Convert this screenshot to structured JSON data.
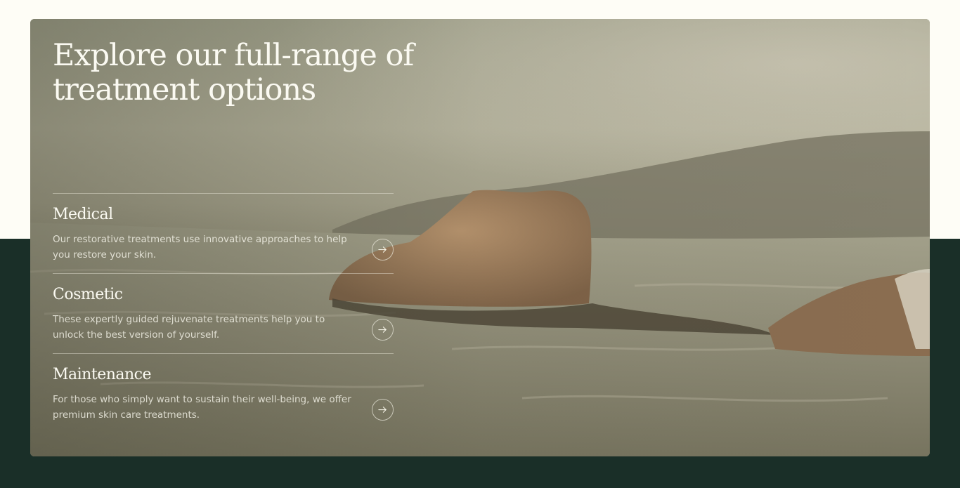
{
  "section": {
    "headline": "Explore our full-range of treatment options",
    "background_image_alt": "Woman floating on her back in calm water at sunset"
  },
  "treatments": [
    {
      "title": "Medical",
      "description": "Our restorative treatments use innovative approaches to help you restore your skin.",
      "icon": "arrow-right-icon"
    },
    {
      "title": "Cosmetic",
      "description": "These expertly guided rejuvenate treatments help you to unlock the best version of yourself.",
      "icon": "arrow-right-icon"
    },
    {
      "title": "Maintenance",
      "description": "For those who simply want to sustain their well-being, we offer premium skin care treatments.",
      "icon": "arrow-right-icon"
    }
  ],
  "colors": {
    "page_top": "#fefdf6",
    "page_bottom": "#1a2f28",
    "text_light": "#fbfaf2"
  }
}
